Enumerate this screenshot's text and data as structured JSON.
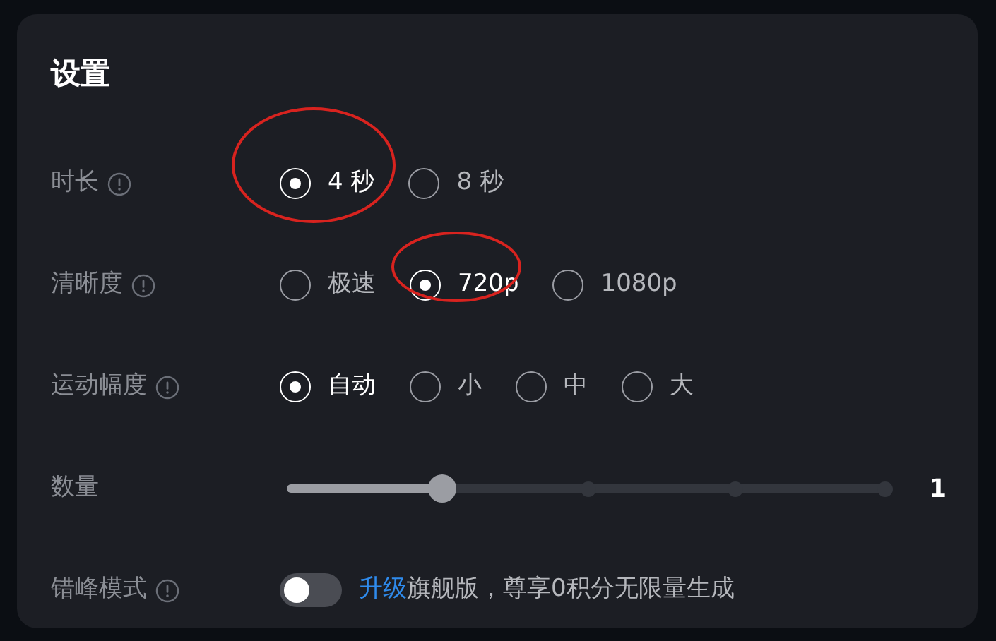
{
  "title": "设置",
  "rows": [
    {
      "kind": "radio",
      "label": "时长",
      "info": true,
      "options": [
        {
          "label": "4 秒",
          "selected": true,
          "circled": true
        },
        {
          "label": "8 秒",
          "selected": false,
          "circled": false
        }
      ]
    },
    {
      "kind": "radio",
      "label": "清晰度",
      "info": true,
      "options": [
        {
          "label": "极速",
          "selected": false,
          "circled": false
        },
        {
          "label": "720p",
          "selected": true,
          "circled": true
        },
        {
          "label": "1080p",
          "selected": false,
          "circled": false
        }
      ]
    },
    {
      "kind": "radio",
      "label": "运动幅度",
      "info": true,
      "options": [
        {
          "label": "自动",
          "selected": true,
          "circled": false
        },
        {
          "label": "小",
          "selected": false,
          "circled": false
        },
        {
          "label": "中",
          "selected": false,
          "circled": false
        },
        {
          "label": "大",
          "selected": false,
          "circled": false
        }
      ]
    },
    {
      "kind": "slider",
      "label": "数量",
      "info": false,
      "level": 0.26,
      "reading": "1"
    },
    {
      "kind": "toggle",
      "label": "错峰模式",
      "info": true,
      "on": false,
      "link": "升级",
      "text": "旗舰版，尊享0积分无限量生成"
    }
  ]
}
